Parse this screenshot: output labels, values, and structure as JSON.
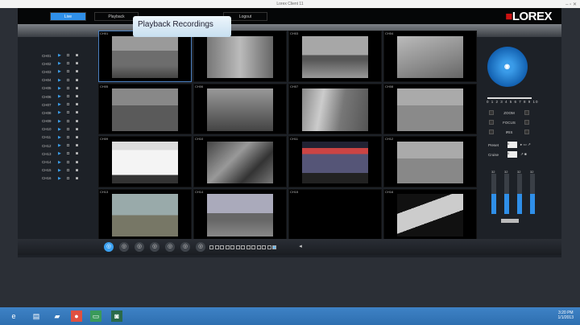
{
  "window": {
    "title": "Lorex Client 11",
    "controls": "–  ▫  ✕"
  },
  "nav": {
    "live": "Live",
    "playback": "Playback",
    "logout": "Logout",
    "tooltip": "Playback Recordings",
    "logo": "LOREX"
  },
  "channels": [
    "CH01",
    "CH02",
    "CH03",
    "CH04",
    "CH05",
    "CH06",
    "CH07",
    "CH08",
    "CH09",
    "CH10",
    "CH11",
    "CH12",
    "CH13",
    "CH14",
    "CH15",
    "CH16"
  ],
  "icons": {
    "play": "▶",
    "record": "◘",
    "snapshot": "◙"
  },
  "ptz": {
    "speed_scale": "0 1 2 3 4 5 6 7 8 9 10",
    "zoom": "ZOOM",
    "focus": "FOCUS",
    "iris": "IRIS",
    "preset": "Preset",
    "cruise": "Cruise",
    "preset_value": "0",
    "cruise_value": "0",
    "sliders": [
      {
        "label": "32",
        "level": 0.5
      },
      {
        "label": "32",
        "level": 0.5
      },
      {
        "label": "32",
        "level": 0.5
      },
      {
        "label": "32",
        "level": 0.5
      }
    ]
  },
  "taskbar": {
    "time": "3:20 PM",
    "date": "1/1/2013"
  },
  "colors": {
    "accent": "#2f8fe8",
    "logo_red": "#cc1111",
    "taskbar": "#3e82c6"
  }
}
